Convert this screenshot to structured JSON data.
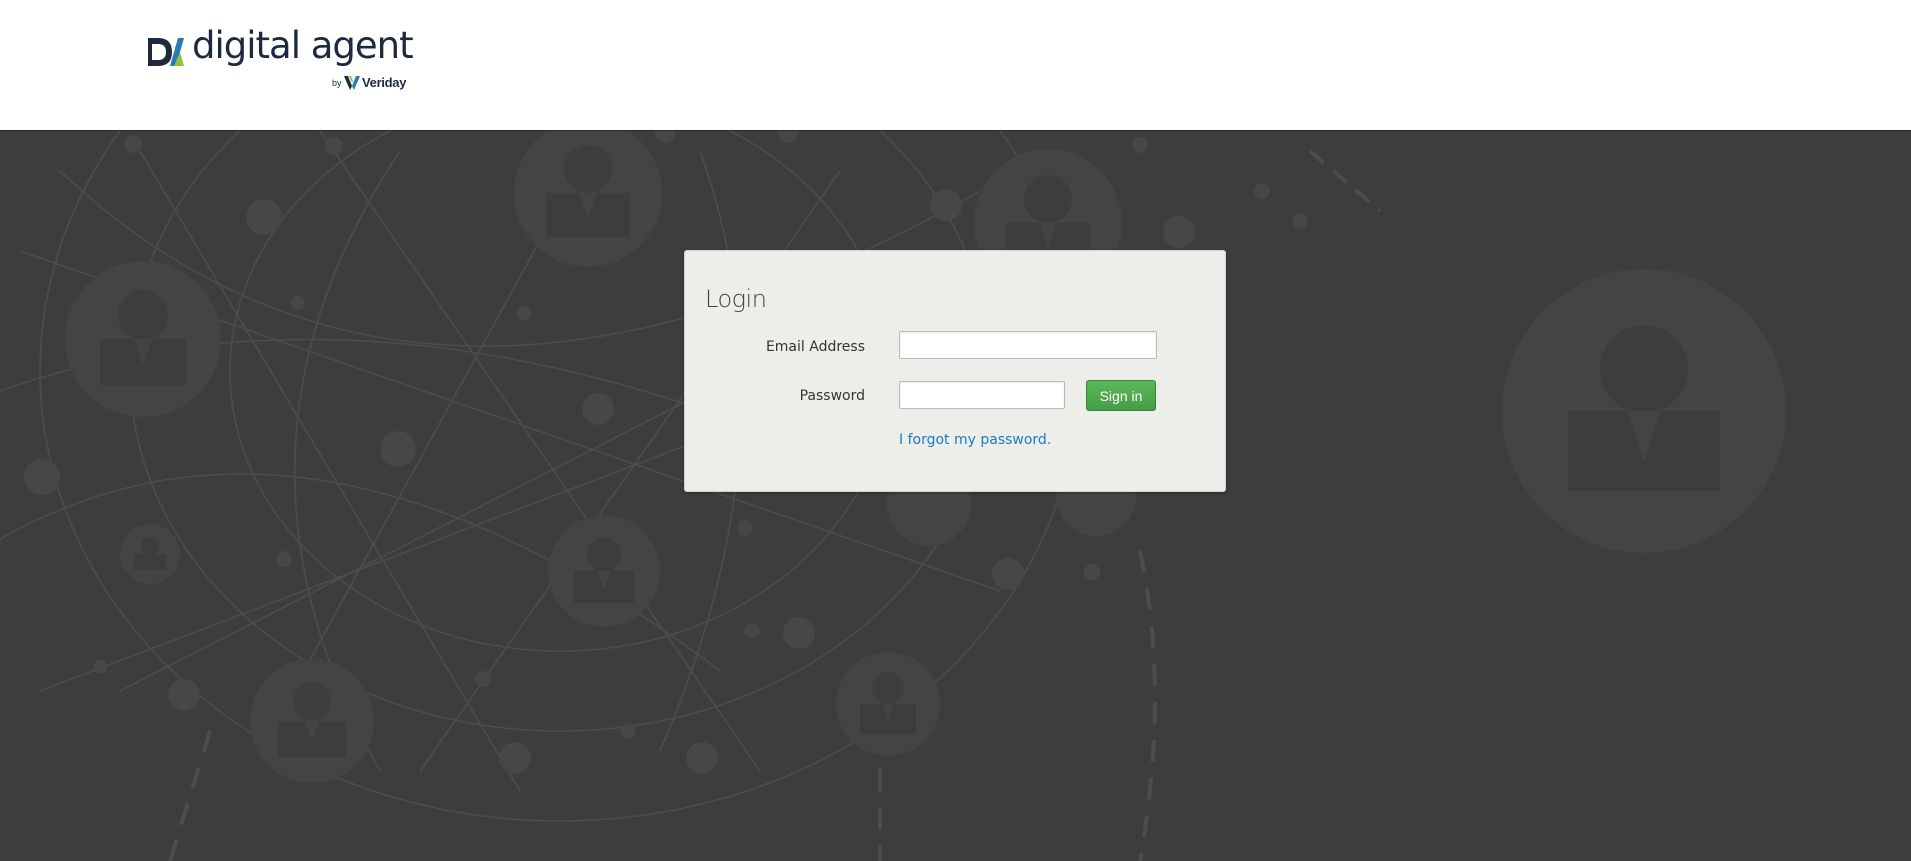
{
  "brand": {
    "name": "digital agent",
    "by": "by",
    "company": "Veriday",
    "colors": {
      "navy": "#1d2a3e",
      "green": "#8cc63f",
      "blue": "#2a7ab8"
    }
  },
  "login": {
    "title": "Login",
    "email_label": "Email Address",
    "email_value": "",
    "password_label": "Password",
    "password_value": "",
    "signin_label": "Sign in",
    "forgot_link": "I forgot my password."
  },
  "colors": {
    "header_bg": "#ffffff",
    "hero_bg": "#3d3d3d",
    "panel_bg": "#ededea",
    "button_green": "#4cae4c",
    "link_blue": "#1c7cc0"
  }
}
